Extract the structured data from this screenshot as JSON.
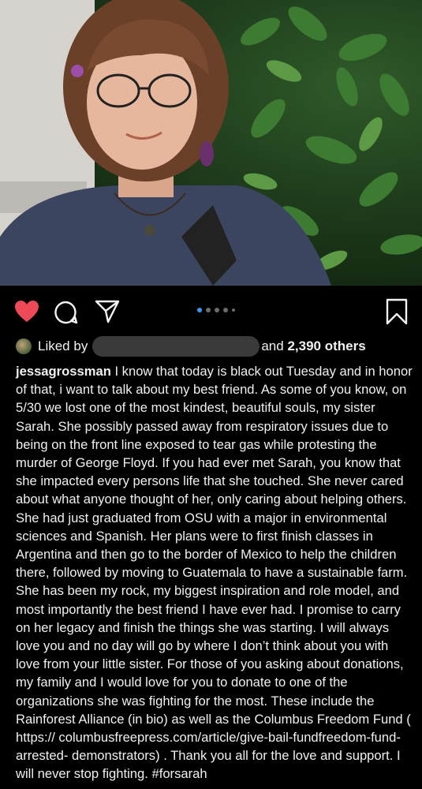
{
  "post": {
    "photo_alt": "Portrait photo",
    "likes": {
      "prefix": "Liked by",
      "and_text": "and",
      "others": "2,390 others"
    },
    "caption": {
      "username": "jessagrossman",
      "text": " I know that today is black out Tuesday and in honor of that, i want to talk about my best friend. As some of you know, on 5/30 we lost one of the most kindest, beautiful souls, my sister Sarah. She possibly passed away from respiratory issues due to being on the front line exposed to tear gas while protesting the murder of George Floyd. If you had ever met Sarah, you know that she impacted every persons life that she touched. She never cared about what anyone thought of her, only caring about helping others. She had just graduated from OSU with a major in environmental sciences and Spanish. Her plans were to first finish classes in Argentina and then go to the border of Mexico to help the children there, followed by moving to Guatemala to have a sustainable farm. She has been my rock, my biggest inspiration and role model, and most importantly the best friend I have ever had. I promise to carry on her legacy and finish the things she was starting. I will always love you and no day will go by where I don’t think about you with love from your little sister. For those of you asking about donations, my family and I would love for you to donate to one of the organizations she was fighting for the most. These include the Rainforest Alliance (in bio) as well as the Columbus Freedom Fund ( https:// columbusfreepress.com/article/give-bail-fundfreedom-fund-arrested- demonstrators) . Thank you all for the love and support. I will never stop fighting. #forsarah"
    },
    "carousel": {
      "total": 5,
      "active": 1
    }
  },
  "colors": {
    "heart": "#ed4956",
    "active_dot": "#3897f0",
    "background": "#000000"
  },
  "icons": [
    "heart-icon",
    "comment-icon",
    "share-icon",
    "bookmark-icon"
  ]
}
